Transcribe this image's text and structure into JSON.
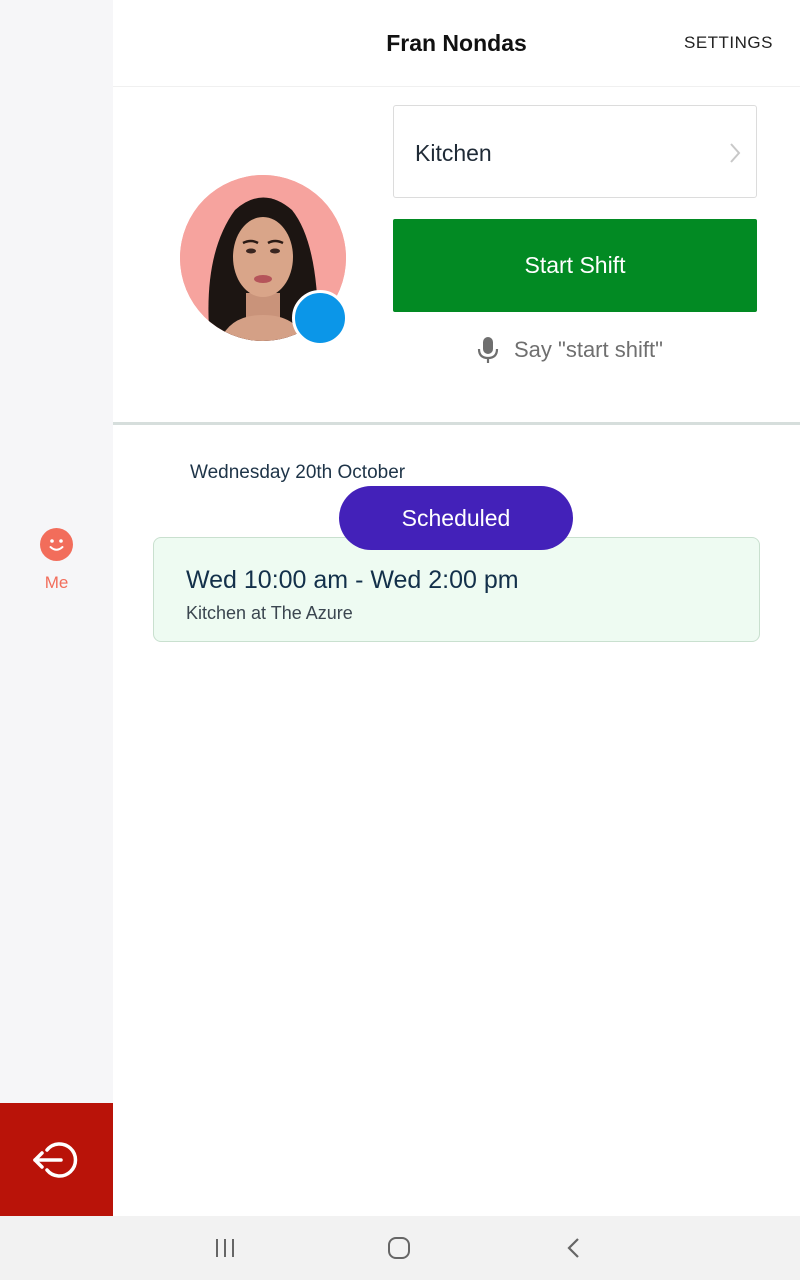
{
  "header": {
    "title": "Fran Nondas",
    "settings_label": "SETTINGS"
  },
  "sidebar": {
    "me_label": "Me"
  },
  "profile": {
    "role": "Kitchen",
    "start_shift_label": "Start Shift",
    "voice_hint": "Say \"start shift\""
  },
  "schedule": {
    "date": "Wednesday 20th October",
    "status": "Scheduled",
    "shift_time": "Wed 10:00 am - Wed 2:00 pm",
    "shift_location": "Kitchen at The Azure"
  },
  "colors": {
    "start_button": "#028a23",
    "status_pill": "#4321b9",
    "logout_bg": "#b91309",
    "accent_me": "#f26d5b",
    "status_dot": "#0b96e8"
  }
}
